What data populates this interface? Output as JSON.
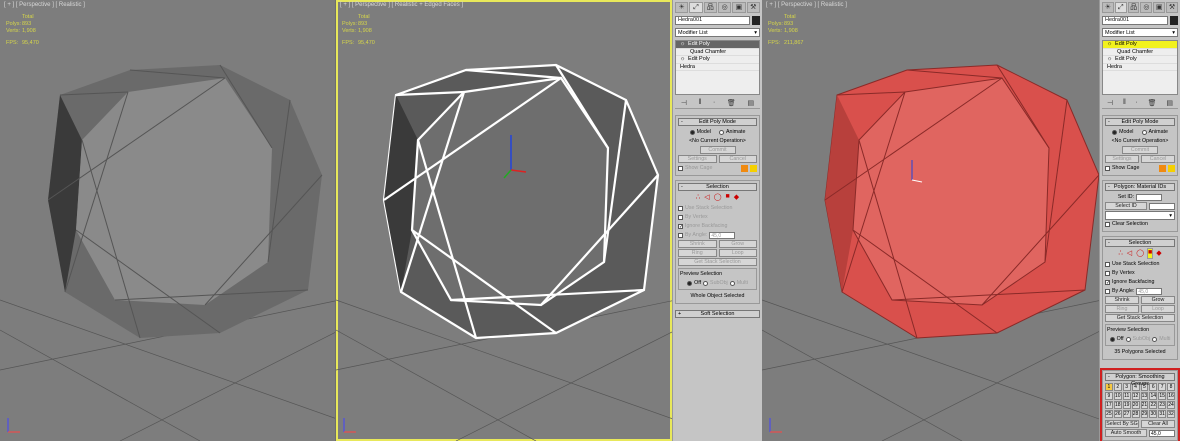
{
  "viewports": [
    {
      "label": "[ + ] [ Perspective ] [ Realistic ]",
      "stats": {
        "header": "Total",
        "polys_label": "Polys:",
        "polys": "893",
        "verts_label": "Verts:",
        "verts": "1,908",
        "fps_label": "FPS:",
        "fps": "95,470"
      }
    },
    {
      "label": "[ + ] [ Perspective ] [ Realistic + Edged Faces ]",
      "stats": {
        "header": "Total",
        "polys_label": "Polys:",
        "polys": "893",
        "verts_label": "Verts:",
        "verts": "1,908",
        "fps_label": "FPS:",
        "fps": "95,470"
      }
    },
    {
      "label": "[ + ] [ Perspective ] [ Realistic ]",
      "stats": {
        "header": "Total",
        "polys_label": "Polys:",
        "polys": "893",
        "verts_label": "Verts:",
        "verts": "1,908",
        "fps_label": "FPS:",
        "fps": "211,867"
      }
    }
  ],
  "panels": [
    {
      "object_name": "Hedra001",
      "modifier_list": "Modifier List",
      "stack": [
        "Edit Poly",
        "Quad Chamfer",
        "Edit Poly",
        "Hedra"
      ],
      "edit_poly_mode": {
        "title": "Edit Poly Mode",
        "model": "Model",
        "animate": "Animate",
        "operation": "<No Current Operation>",
        "commit": "Commit",
        "settings": "Settings",
        "cancel": "Cancel",
        "show_cage": "Show Cage"
      },
      "selection": {
        "title": "Selection",
        "use_stack": "Use Stack Selection",
        "by_vertex": "By Vertex",
        "ignore_backfacing": "Ignore Backfacing",
        "by_angle": "By Angle:",
        "angle": "45,0",
        "shrink": "Shrink",
        "grow": "Grow",
        "ring": "Ring",
        "loop": "Loop",
        "get_stack": "Get Stack Selection",
        "preview": "Preview Selection",
        "off": "Off",
        "subobj": "SubObj",
        "multi": "Multi",
        "status": "Whole Object Selected"
      },
      "soft_selection": "Soft Selection"
    },
    {
      "object_name": "Hedra001",
      "modifier_list": "Modifier List",
      "stack": [
        "Edit Poly",
        "Quad Chamfer",
        "Edit Poly",
        "Hedra"
      ],
      "edit_poly_mode": {
        "title": "Edit Poly Mode",
        "model": "Model",
        "animate": "Animate",
        "operation": "<No Current Operation>",
        "commit": "Commit",
        "settings": "Settings",
        "cancel": "Cancel",
        "show_cage": "Show Cage"
      },
      "material_ids": {
        "title": "Polygon: Material IDs",
        "set_id": "Set ID:",
        "select_id": "Select ID",
        "clear_selection": "Clear Selection"
      },
      "selection": {
        "title": "Selection",
        "use_stack": "Use Stack Selection",
        "by_vertex": "By Vertex",
        "ignore_backfacing": "Ignore Backfacing",
        "by_angle": "By Angle:",
        "angle": "45,0",
        "shrink": "Shrink",
        "grow": "Grow",
        "ring": "Ring",
        "loop": "Loop",
        "get_stack": "Get Stack Selection",
        "preview": "Preview Selection",
        "off": "Off",
        "subobj": "SubObj",
        "multi": "Multi",
        "status": "35 Polygons Selected"
      },
      "smoothing": {
        "title": "Polygon: Smoothing Groups",
        "groups": [
          "1",
          "2",
          "3",
          "4",
          "5",
          "6",
          "7",
          "8",
          "9",
          "10",
          "11",
          "12",
          "13",
          "14",
          "15",
          "16",
          "17",
          "18",
          "19",
          "20",
          "21",
          "22",
          "23",
          "24",
          "25",
          "26",
          "27",
          "28",
          "29",
          "30",
          "31",
          "32"
        ],
        "active": "1",
        "select_by_sg": "Select By SG",
        "clear_all": "Clear All",
        "auto_smooth": "Auto Smooth",
        "auto_value": "45,0"
      }
    }
  ],
  "colors": {
    "viewport": "#7d7d7d",
    "active_border": "#e8e85a",
    "gem_red": "#d9504c",
    "highlight": "#f2f21e",
    "callout": "#d02020"
  }
}
